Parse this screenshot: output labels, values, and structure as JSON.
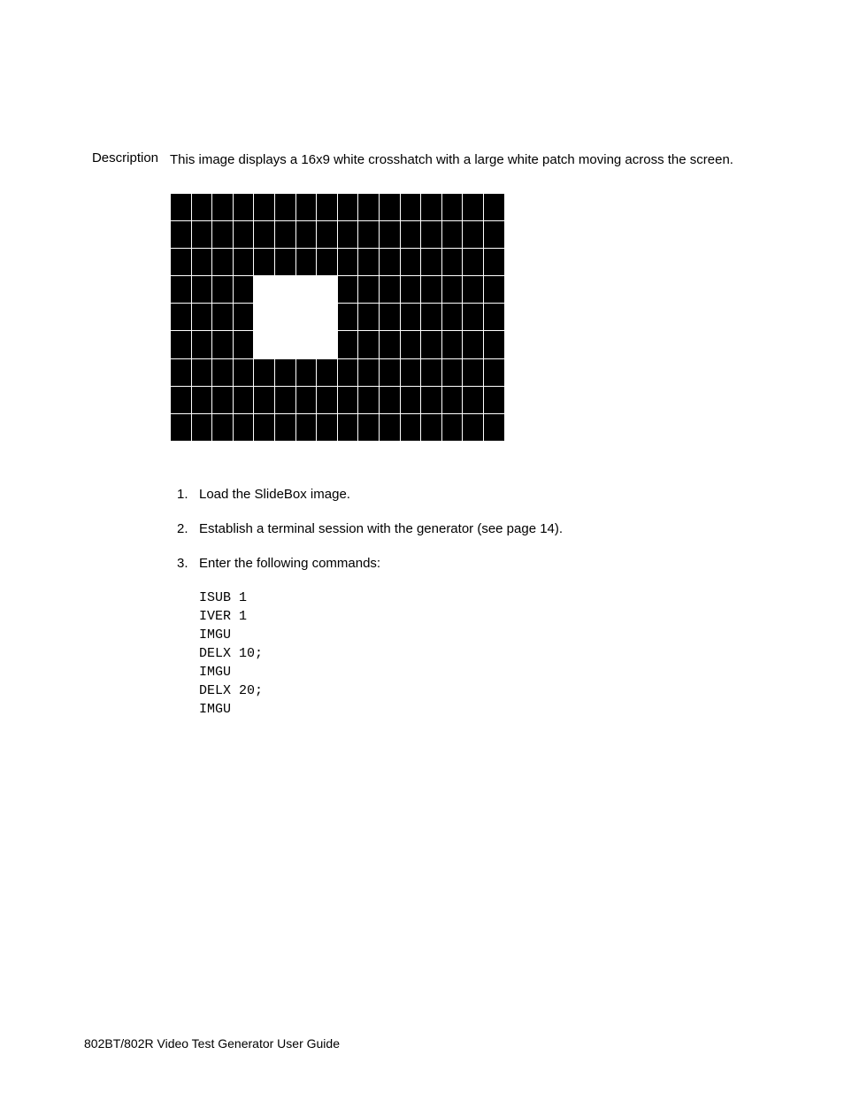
{
  "description": {
    "label": "Description",
    "text": "This image displays a 16x9 white crosshatch with a large white patch moving across the screen."
  },
  "crosshatch": {
    "rows": 9,
    "cols": 16,
    "patch": {
      "rowStart": 3,
      "rowEnd": 5,
      "colStart": 4,
      "colEnd": 7
    }
  },
  "steps": [
    {
      "num": "1.",
      "text": "Load the SlideBox image."
    },
    {
      "num": "2.",
      "text": "Establish a terminal session with the generator (see page 14)."
    },
    {
      "num": "3.",
      "text": "Enter the following commands:"
    }
  ],
  "code": "ISUB 1\nIVER 1\nIMGU\nDELX 10;\nIMGU\nDELX 20;\nIMGU",
  "footer": "802BT/802R Video Test Generator User Guide"
}
